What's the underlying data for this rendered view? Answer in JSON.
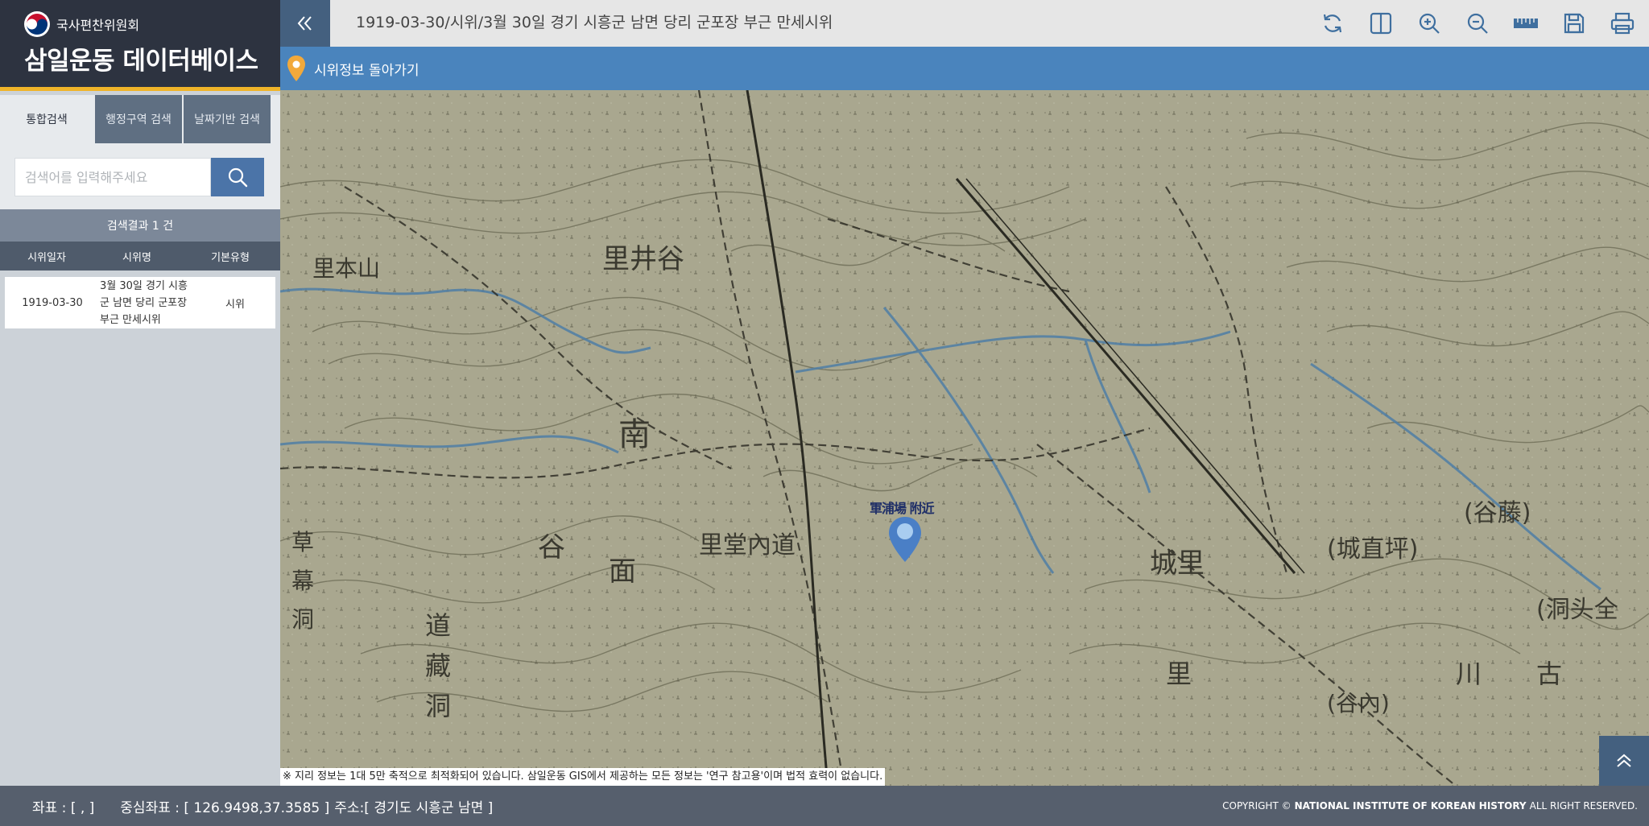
{
  "brand": {
    "org_name": "국사편찬위원회",
    "title": "삼일운동 데이터베이스"
  },
  "tabs": [
    {
      "label": "통합검색",
      "active": true
    },
    {
      "label": "행정구역 검색",
      "active": false
    },
    {
      "label": "날짜기반 검색",
      "active": false
    }
  ],
  "search": {
    "placeholder": "검색어를 입력해주세요",
    "value": "",
    "button_icon": "search-icon"
  },
  "results": {
    "count_text": "검색결과 1 건",
    "columns": [
      "시위일자",
      "시위명",
      "기본유형"
    ],
    "rows": [
      {
        "date": "1919-03-30",
        "name": "3월 30일 경기 시흥군 남면 당리 군포장 부근 만세시위",
        "type": "시위"
      }
    ]
  },
  "header": {
    "collapse_icon": "double-chevron-left-icon",
    "title": "1919-03-30/시위/3월 30일 경기 시흥군 남면 당리 군포장 부근 만세시위",
    "tools": [
      "refresh-icon",
      "split-view-icon",
      "zoom-in-icon",
      "zoom-out-icon",
      "ruler-icon",
      "save-icon",
      "print-icon"
    ]
  },
  "back_bar": {
    "icon": "location-pin-icon",
    "label": "시위정보 돌아가기"
  },
  "map": {
    "marker_label": "軍浦場 附近",
    "map_labels": [
      "南",
      "面",
      "里堂內道",
      "城里",
      "里井谷",
      "里本山",
      "(谷內)",
      "(城直坪)",
      "(谷藤)",
      "(洞头全",
      "道",
      "藏",
      "洞",
      "草",
      "幕",
      "洞",
      "谷",
      "里",
      "川",
      "古"
    ],
    "notice": "※ 지리 정보는 1대 5만 축적으로 최적화되어 있습니다. 삼일운동 GIS에서 제공하는 모든 정보는 '연구 참고용'이며 법적 효력이 없습니다.",
    "colors": {
      "paper": "#a6a48d",
      "contour": "#6b6a58",
      "river": "#4f7ea6",
      "marker": "#4a7fc6"
    }
  },
  "footer": {
    "coords_label": "좌표 : [ , ]",
    "center_label": "중심좌표 : [ 126.9498,37.3585 ]",
    "address_label": "주소:[ 경기도 시흥군 남면 ]",
    "copyright_prefix": "COPYRIGHT ©",
    "copyright_org": "NATIONAL INSTITUTE OF KOREAN HISTORY",
    "copyright_suffix": "ALL RIGHT RESERVED."
  }
}
